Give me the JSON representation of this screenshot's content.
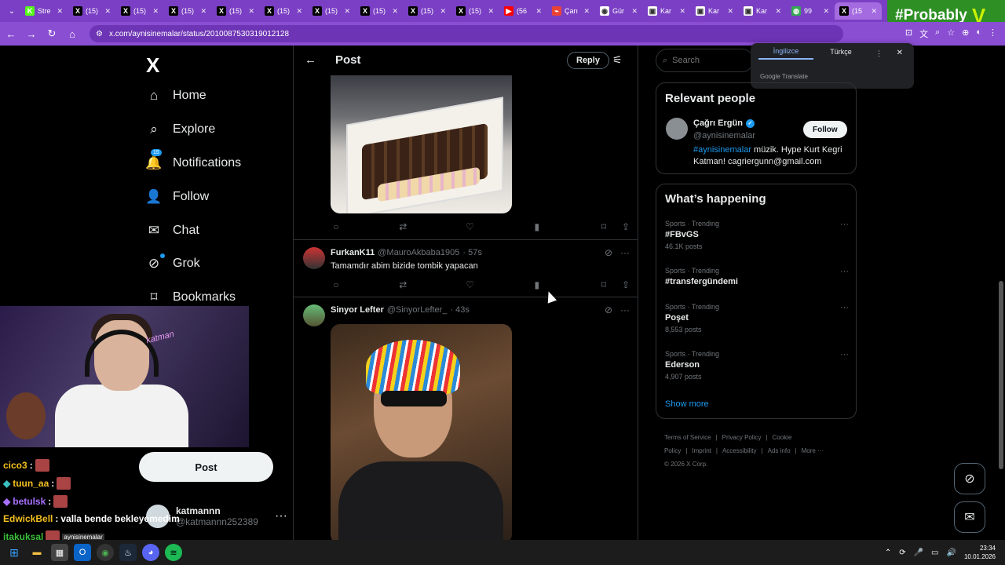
{
  "browser": {
    "tabs": [
      {
        "label": "Stre",
        "favicon": "K",
        "color": "#53fc18"
      },
      {
        "label": "(15)",
        "favicon": "X",
        "color": "#000000"
      },
      {
        "label": "(15)",
        "favicon": "X",
        "color": "#000000"
      },
      {
        "label": "(15)",
        "favicon": "X",
        "color": "#000000"
      },
      {
        "label": "(15)",
        "favicon": "X",
        "color": "#000000"
      },
      {
        "label": "(15)",
        "favicon": "X",
        "color": "#000000"
      },
      {
        "label": "(15)",
        "favicon": "X",
        "color": "#000000"
      },
      {
        "label": "(15)",
        "favicon": "X",
        "color": "#000000"
      },
      {
        "label": "(15)",
        "favicon": "X",
        "color": "#000000"
      },
      {
        "label": "(15)",
        "favicon": "X",
        "color": "#000000"
      },
      {
        "label": "(56",
        "favicon": "▶",
        "color": "#ff0000"
      },
      {
        "label": "Çarı",
        "favicon": "⌁",
        "color": "#ea4335"
      },
      {
        "label": "Gür",
        "favicon": "◉",
        "color": "#ffffff"
      },
      {
        "label": "Kar",
        "favicon": "▣",
        "color": "#ffffff"
      },
      {
        "label": "Kar",
        "favicon": "▣",
        "color": "#ffffff"
      },
      {
        "label": "Kar",
        "favicon": "▣",
        "color": "#ffffff"
      },
      {
        "label": "99",
        "favicon": "◍",
        "color": "#34a853"
      },
      {
        "label": "(15",
        "favicon": "X",
        "color": "#000000",
        "active": true
      }
    ],
    "url": "x.com/aynisinemalar/status/2010087530319012128",
    "overlay_badge": "#Probably"
  },
  "sidebar": {
    "logo": "X",
    "items": [
      {
        "label": "Home",
        "icon": "⌂"
      },
      {
        "label": "Explore",
        "icon": "⌕"
      },
      {
        "label": "Notifications",
        "icon": "🔔",
        "badge": "15"
      },
      {
        "label": "Follow",
        "icon": "👤+"
      },
      {
        "label": "Chat",
        "icon": "✉"
      },
      {
        "label": "Grok",
        "icon": "⊘"
      },
      {
        "label": "Bookmarks",
        "icon": "🔖"
      }
    ],
    "post_button": "Post",
    "account": {
      "name": "katmannn",
      "handle": "@katmannn252389",
      "more": "···"
    }
  },
  "webcam": {
    "neon_text": "katman"
  },
  "chat": [
    {
      "user": "cico3",
      "color": "#f4c020",
      "message": ""
    },
    {
      "user": "tuun_aa",
      "color": "#f4c020",
      "message": ""
    },
    {
      "user": "betulsk",
      "color": "#a970ff",
      "message": ""
    },
    {
      "user": "EdwickBell",
      "color": "#f4c020",
      "message": "valla bende bekleyemedim"
    },
    {
      "user": "itakuksal",
      "color": "#3ac03a",
      "message": ""
    }
  ],
  "chat_clip_label": "aynisinemalar",
  "center": {
    "title": "Post",
    "reply_button": "Reply",
    "replies": [
      {
        "name": "FurkanK11",
        "handle": "@MauroAkbaba1905",
        "time": "· 57s",
        "text": "Tamamdır abim bizide tombik yapacan"
      },
      {
        "name": "Sinyor Lefter",
        "handle": "@SinyorLefter_",
        "time": "· 43s",
        "text": ""
      }
    ],
    "actions": {
      "reply": "○",
      "repost": "⇄",
      "like": "♡",
      "views": "▮",
      "bookmark": "⌑",
      "share": "⇪"
    }
  },
  "right": {
    "search_placeholder": "Search",
    "translate": {
      "tab_en": "İngilizce",
      "tab_tr": "Türkçe",
      "menu": "⋮",
      "close": "✕",
      "powered": "Google Translate"
    },
    "relevant_people": {
      "title": "Relevant people",
      "name": "Çağrı Ergün",
      "handle": "@aynisinemalar",
      "bio_tag": "#aynisinemalar",
      "bio_text": " müzik. Hype Kurt Kegri Katman! cagriergunn@gmail.com",
      "follow_button": "Follow"
    },
    "happening": {
      "title": "What’s happening",
      "trends": [
        {
          "category": "Sports · Trending",
          "title": "#FBvGS",
          "count": "46.1K posts"
        },
        {
          "category": "Sports · Trending",
          "title": "#transfergündemi",
          "count": ""
        },
        {
          "category": "Sports · Trending",
          "title": "Poşet",
          "count": "8,553 posts"
        },
        {
          "category": "Sports · Trending",
          "title": "Ederson",
          "count": "4,907 posts"
        }
      ],
      "show_more": "Show more"
    },
    "footer": {
      "links": [
        "Terms of Service",
        "|",
        "Privacy Policy",
        "|",
        "Cookie Policy",
        "|",
        "Imprint",
        "|",
        "Accessibility",
        "|",
        "Ads info",
        "|",
        "More ···"
      ],
      "copyright": "© 2026 X Corp."
    }
  },
  "taskbar": {
    "time": "23:34",
    "date": "10.01.2026"
  },
  "colors": {
    "accent": "#1d9bf0",
    "browser": "#8a4ed3",
    "background": "#000000"
  }
}
